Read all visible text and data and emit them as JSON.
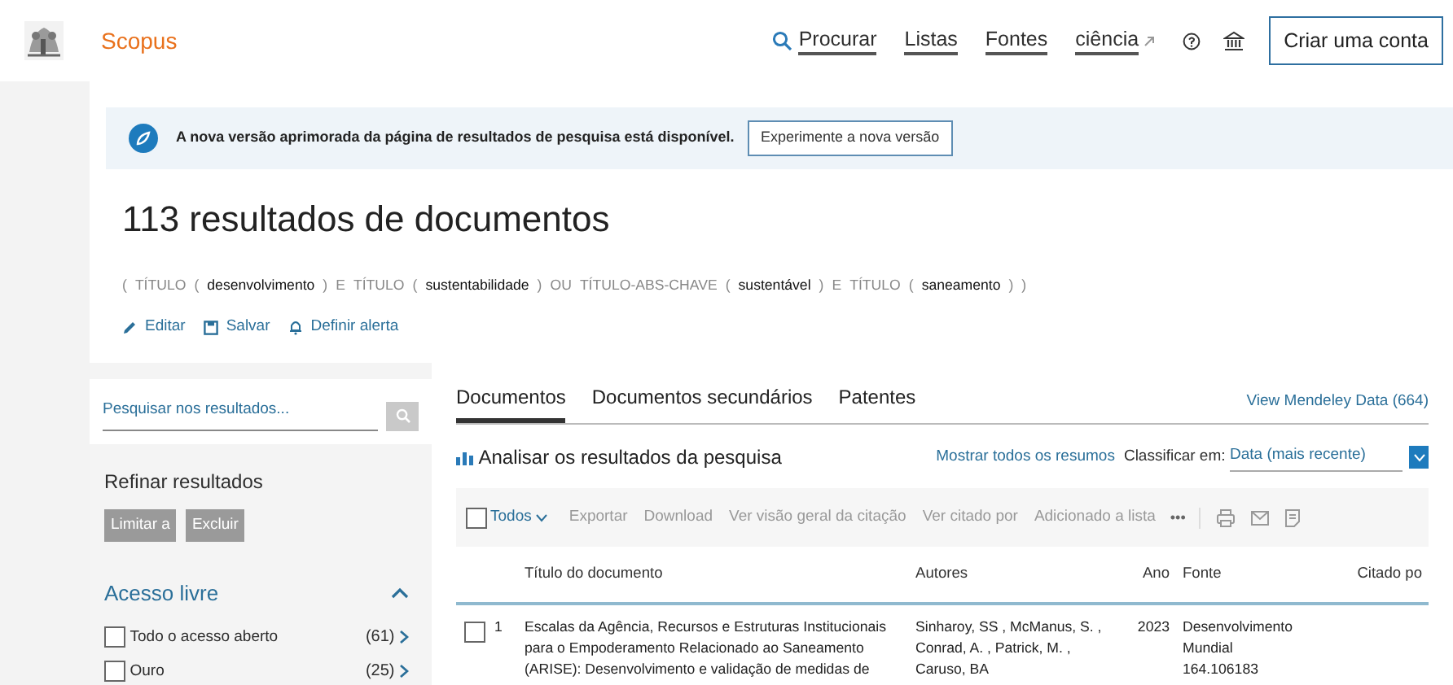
{
  "header": {
    "brand": "Scopus",
    "nav": [
      {
        "label": "Procurar",
        "external": false
      },
      {
        "label": "Listas",
        "external": false
      },
      {
        "label": "Fontes",
        "external": false
      },
      {
        "label": "ciência",
        "external": true
      }
    ],
    "account_button": "Criar uma conta"
  },
  "banner": {
    "message": "A nova versão aprimorada da página de resultados de pesquisa está disponível.",
    "button": "Experimente a nova versão"
  },
  "results": {
    "title": "113 resultados de documentos",
    "query": [
      {
        "text": "(",
        "kind": "op"
      },
      {
        "text": "TÍTULO",
        "kind": "op"
      },
      {
        "text": "(",
        "kind": "op"
      },
      {
        "text": "desenvolvimento",
        "kind": "term"
      },
      {
        "text": ")",
        "kind": "op"
      },
      {
        "text": "E",
        "kind": "op"
      },
      {
        "text": "TÍTULO",
        "kind": "op"
      },
      {
        "text": "(",
        "kind": "op"
      },
      {
        "text": "sustentabilidade",
        "kind": "term"
      },
      {
        "text": ")",
        "kind": "op"
      },
      {
        "text": "OU",
        "kind": "op"
      },
      {
        "text": "TÍTULO-ABS-CHAVE",
        "kind": "op"
      },
      {
        "text": "(",
        "kind": "op"
      },
      {
        "text": "sustentável",
        "kind": "term"
      },
      {
        "text": ")",
        "kind": "op"
      },
      {
        "text": "E",
        "kind": "op"
      },
      {
        "text": "TÍTULO",
        "kind": "op"
      },
      {
        "text": "(",
        "kind": "op"
      },
      {
        "text": "saneamento",
        "kind": "term"
      },
      {
        "text": ")",
        "kind": "op"
      },
      {
        "text": ")",
        "kind": "op"
      }
    ],
    "actions": [
      {
        "label": "Editar"
      },
      {
        "label": "Salvar"
      },
      {
        "label": "Definir alerta"
      }
    ]
  },
  "sidebar": {
    "search_placeholder": "Pesquisar nos resultados...",
    "heading": "Refinar resultados",
    "buttons": [
      {
        "label": "Limitar a",
        "disabled": true
      },
      {
        "label": "Excluir",
        "disabled": true
      }
    ],
    "filter": {
      "title": "Acesso livre",
      "expanded": true,
      "options": [
        {
          "label": "Todo o acesso aberto",
          "count": "(61)",
          "checked": false
        },
        {
          "label": "Ouro",
          "count": "(25)",
          "checked": false
        }
      ]
    }
  },
  "tabs": [
    {
      "label": "Documentos",
      "selected": true
    },
    {
      "label": "Documentos secundários",
      "selected": false
    },
    {
      "label": "Patentes",
      "selected": false
    }
  ],
  "mendeley_link": "View Mendeley Data (664)",
  "analyze_link": "Analisar os resultados da pesquisa",
  "show_abstracts": "Mostrar todos os resumos",
  "sort_label": "Classificar em:",
  "sort_value": "Data (mais recente)",
  "toolbar": {
    "select_all": "Todos",
    "select_all_checked": false,
    "actions": [
      {
        "label": "Exportar",
        "disabled": true
      },
      {
        "label": "Download",
        "disabled": true
      },
      {
        "label": "Ver visão geral da citação",
        "disabled": true
      },
      {
        "label": "Ver citado por",
        "disabled": true
      },
      {
        "label": "Adicionado a lista",
        "disabled": true
      }
    ],
    "more": "•••"
  },
  "table": {
    "columns": [
      "Título do documento",
      "Autores",
      "Ano",
      "Fonte",
      "Citado po"
    ],
    "rows": [
      {
        "number": "1",
        "checked": false,
        "title": [
          "Escalas da Agência, Recursos e Estruturas Institucionais",
          "para o Empoderamento Relacionado ao Saneamento",
          "(ARISE): Desenvolvimento e validação de medidas de"
        ],
        "authors": [
          "Sinharoy, SS , McManus, S. ,",
          "Conrad, A. , Patrick, M. ,",
          "Caruso, BA"
        ],
        "year": "2023",
        "source": [
          "Desenvolvimento",
          "Mundial",
          "164.106183"
        ]
      }
    ]
  }
}
